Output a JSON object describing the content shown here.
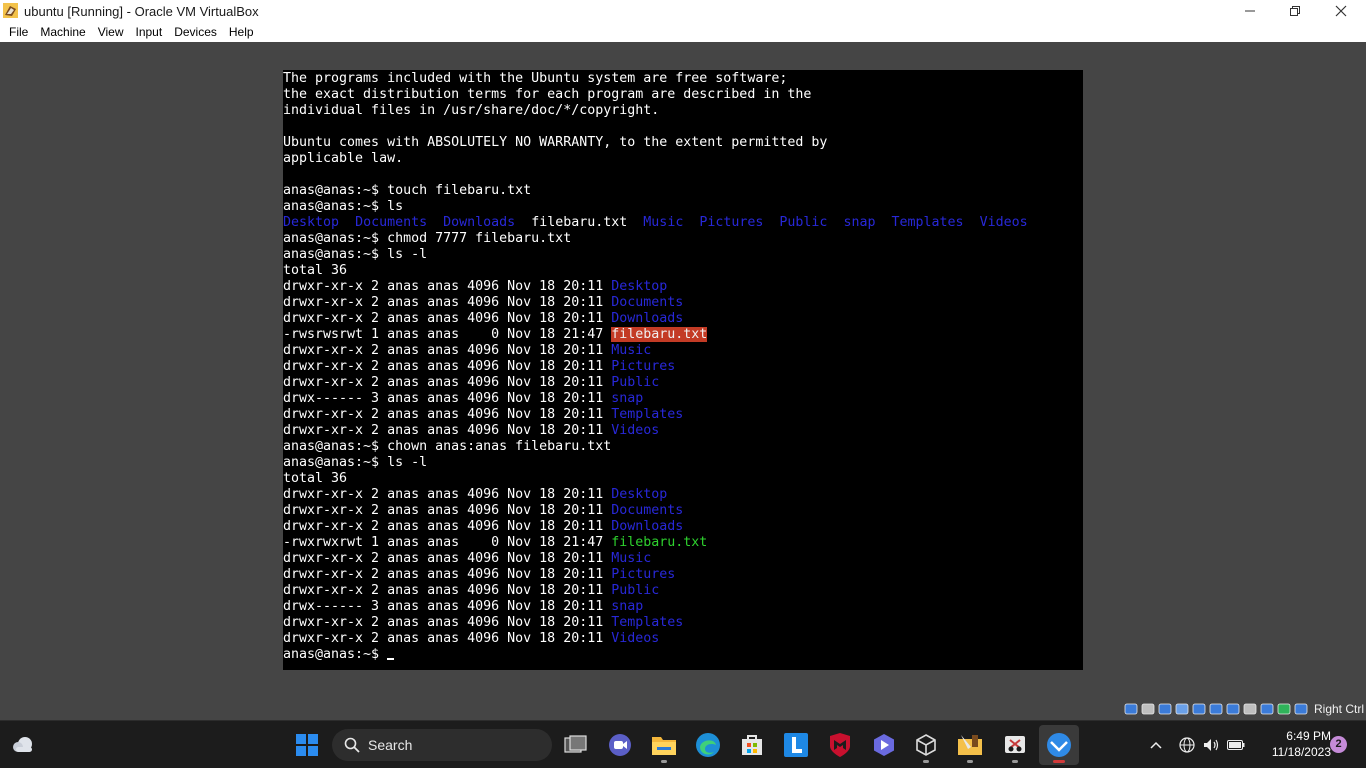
{
  "window": {
    "title": "ubuntu [Running] - Oracle VM VirtualBox"
  },
  "menu": [
    "File",
    "Machine",
    "View",
    "Input",
    "Devices",
    "Help"
  ],
  "terminal": {
    "lines": [
      [
        {
          "t": "The programs included with the Ubuntu system are free software;"
        }
      ],
      [
        {
          "t": "the exact distribution terms for each program are described in the"
        }
      ],
      [
        {
          "t": "individual files in /usr/share/doc/*/copyright."
        }
      ],
      [
        {
          "t": ""
        }
      ],
      [
        {
          "t": "Ubuntu comes with ABSOLUTELY NO WARRANTY, to the extent permitted by"
        }
      ],
      [
        {
          "t": "applicable law."
        }
      ],
      [
        {
          "t": ""
        }
      ],
      [
        {
          "t": "anas@anas:~$ touch filebaru.txt"
        }
      ],
      [
        {
          "t": "anas@anas:~$ ls"
        }
      ],
      [
        {
          "t": "Desktop",
          "c": "dir"
        },
        {
          "t": "  "
        },
        {
          "t": "Documents",
          "c": "dir"
        },
        {
          "t": "  "
        },
        {
          "t": "Downloads",
          "c": "dir"
        },
        {
          "t": "  filebaru.txt  "
        },
        {
          "t": "Music",
          "c": "dir"
        },
        {
          "t": "  "
        },
        {
          "t": "Pictures",
          "c": "dir"
        },
        {
          "t": "  "
        },
        {
          "t": "Public",
          "c": "dir"
        },
        {
          "t": "  "
        },
        {
          "t": "snap",
          "c": "dir"
        },
        {
          "t": "  "
        },
        {
          "t": "Templates",
          "c": "dir"
        },
        {
          "t": "  "
        },
        {
          "t": "Videos",
          "c": "dir"
        }
      ],
      [
        {
          "t": "anas@anas:~$ chmod 7777 filebaru.txt"
        }
      ],
      [
        {
          "t": "anas@anas:~$ ls -l"
        }
      ],
      [
        {
          "t": "total 36"
        }
      ],
      [
        {
          "t": "drwxr-xr-x 2 anas anas 4096 Nov 18 20:11 "
        },
        {
          "t": "Desktop",
          "c": "dir"
        }
      ],
      [
        {
          "t": "drwxr-xr-x 2 anas anas 4096 Nov 18 20:11 "
        },
        {
          "t": "Documents",
          "c": "dir"
        }
      ],
      [
        {
          "t": "drwxr-xr-x 2 anas anas 4096 Nov 18 20:11 "
        },
        {
          "t": "Downloads",
          "c": "dir"
        }
      ],
      [
        {
          "t": "-rwsrwsrwt 1 anas anas    0 Nov 18 21:47 "
        },
        {
          "t": "filebaru.txt",
          "c": "hl-red"
        }
      ],
      [
        {
          "t": "drwxr-xr-x 2 anas anas 4096 Nov 18 20:11 "
        },
        {
          "t": "Music",
          "c": "dir"
        }
      ],
      [
        {
          "t": "drwxr-xr-x 2 anas anas 4096 Nov 18 20:11 "
        },
        {
          "t": "Pictures",
          "c": "dir"
        }
      ],
      [
        {
          "t": "drwxr-xr-x 2 anas anas 4096 Nov 18 20:11 "
        },
        {
          "t": "Public",
          "c": "dir"
        }
      ],
      [
        {
          "t": "drwx------ 3 anas anas 4096 Nov 18 20:11 "
        },
        {
          "t": "snap",
          "c": "dir"
        }
      ],
      [
        {
          "t": "drwxr-xr-x 2 anas anas 4096 Nov 18 20:11 "
        },
        {
          "t": "Templates",
          "c": "dir"
        }
      ],
      [
        {
          "t": "drwxr-xr-x 2 anas anas 4096 Nov 18 20:11 "
        },
        {
          "t": "Videos",
          "c": "dir"
        }
      ],
      [
        {
          "t": "anas@anas:~$ chown anas:anas filebaru.txt"
        }
      ],
      [
        {
          "t": "anas@anas:~$ ls -l"
        }
      ],
      [
        {
          "t": "total 36"
        }
      ],
      [
        {
          "t": "drwxr-xr-x 2 anas anas 4096 Nov 18 20:11 "
        },
        {
          "t": "Desktop",
          "c": "dir"
        }
      ],
      [
        {
          "t": "drwxr-xr-x 2 anas anas 4096 Nov 18 20:11 "
        },
        {
          "t": "Documents",
          "c": "dir"
        }
      ],
      [
        {
          "t": "drwxr-xr-x 2 anas anas 4096 Nov 18 20:11 "
        },
        {
          "t": "Downloads",
          "c": "dir"
        }
      ],
      [
        {
          "t": "-rwxrwxrwt 1 anas anas    0 Nov 18 21:47 "
        },
        {
          "t": "filebaru.txt",
          "c": "exe"
        }
      ],
      [
        {
          "t": "drwxr-xr-x 2 anas anas 4096 Nov 18 20:11 "
        },
        {
          "t": "Music",
          "c": "dir"
        }
      ],
      [
        {
          "t": "drwxr-xr-x 2 anas anas 4096 Nov 18 20:11 "
        },
        {
          "t": "Pictures",
          "c": "dir"
        }
      ],
      [
        {
          "t": "drwxr-xr-x 2 anas anas 4096 Nov 18 20:11 "
        },
        {
          "t": "Public",
          "c": "dir"
        }
      ],
      [
        {
          "t": "drwx------ 3 anas anas 4096 Nov 18 20:11 "
        },
        {
          "t": "snap",
          "c": "dir"
        }
      ],
      [
        {
          "t": "drwxr-xr-x 2 anas anas 4096 Nov 18 20:11 "
        },
        {
          "t": "Templates",
          "c": "dir"
        }
      ],
      [
        {
          "t": "drwxr-xr-x 2 anas anas 4096 Nov 18 20:11 "
        },
        {
          "t": "Videos",
          "c": "dir"
        }
      ]
    ],
    "prompt": "anas@anas:~$ ",
    "colors": {
      "dir": "#2828d8",
      "setuid_bg": "#c33b25",
      "exec": "#2ed12e"
    }
  },
  "statusbar": {
    "icons": [
      "hard-disk-icon",
      "optical-drive-icon",
      "audio-icon",
      "network-icon",
      "usb-icon",
      "shared-folder-icon",
      "display-icon",
      "recording-icon",
      "cpu-icon",
      "mouse-integration-icon",
      "keyboard-icon"
    ],
    "host_key": "Right Ctrl"
  },
  "taskbar": {
    "search_label": "Search",
    "apps": [
      "start-button",
      "task-view",
      "meet-chat",
      "file-explorer",
      "edge",
      "microsoft-store",
      "l-app",
      "mcafee",
      "app-purple",
      "virtualbox",
      "folder-app",
      "snipping-tool",
      "virtualbox-vm"
    ],
    "time": "6:49 PM",
    "date": "11/18/2023",
    "notification_count": "2"
  }
}
